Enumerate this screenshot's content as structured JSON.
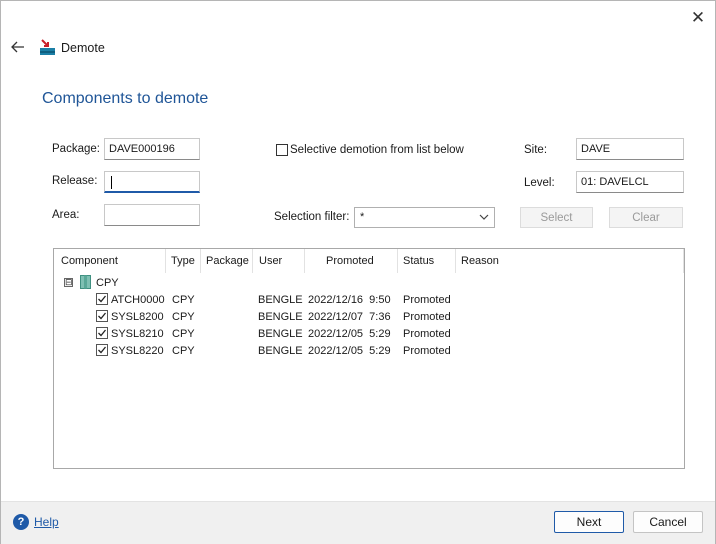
{
  "window": {
    "title": "Demote",
    "close_glyph": "✕"
  },
  "heading": "Components to demote",
  "form": {
    "package_label": "Package:",
    "package_value": "DAVE000196",
    "release_label": "Release:",
    "release_value": "",
    "area_label": "Area:",
    "area_value": "",
    "selective_label": "Selective demotion from list below",
    "selective_checked": false,
    "site_label": "Site:",
    "site_value": "DAVE",
    "level_label": "Level:",
    "level_value": "01: DAVELCL",
    "filter_label": "Selection filter:",
    "filter_value": "*",
    "select_button": "Select",
    "clear_button": "Clear"
  },
  "grid": {
    "columns": [
      "Component",
      "Type",
      "Package",
      "User",
      "Promoted",
      "Status",
      "Reason"
    ],
    "group": {
      "toggle": "⊟",
      "label": "CPY"
    },
    "rows": [
      {
        "component": "ATCH0000",
        "type": "CPY",
        "package": "",
        "user": "BENGLE",
        "promoted": "2022/12/16  9:50",
        "status": "Promoted",
        "reason": "",
        "checked": true
      },
      {
        "component": "SYSL8200",
        "type": "CPY",
        "package": "",
        "user": "BENGLE",
        "promoted": "2022/12/07  7:36",
        "status": "Promoted",
        "reason": "",
        "checked": true
      },
      {
        "component": "SYSL8210",
        "type": "CPY",
        "package": "",
        "user": "BENGLE",
        "promoted": "2022/12/05  5:29",
        "status": "Promoted",
        "reason": "",
        "checked": true
      },
      {
        "component": "SYSL8220",
        "type": "CPY",
        "package": "",
        "user": "BENGLE",
        "promoted": "2022/12/05  5:29",
        "status": "Promoted",
        "reason": "",
        "checked": true
      }
    ]
  },
  "footer": {
    "help_glyph": "?",
    "help_label": "Help",
    "next_label": "Next",
    "cancel_label": "Cancel"
  },
  "colors": {
    "accent": "#1f5aa8",
    "heading": "#1f5597"
  }
}
